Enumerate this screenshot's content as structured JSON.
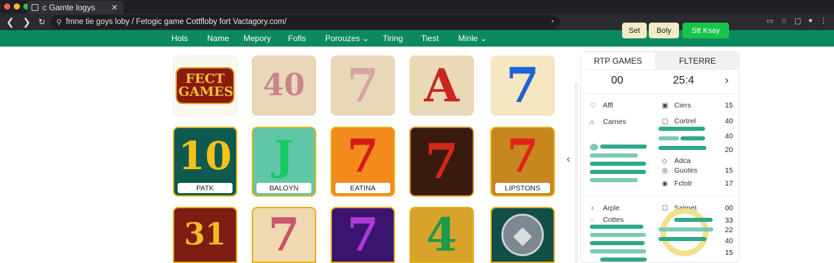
{
  "browser": {
    "tab_title": "c Gamte logys",
    "tab_close": "✕",
    "url": "fmne tie goys loby / Fetogic game Cottfloby fort Vactagory.com/",
    "back": "❮",
    "forward": "❯",
    "reload": "↻"
  },
  "nav": {
    "items": [
      "Hols",
      "Name",
      "Mepory",
      "Fofis",
      "Porouzes ⌄",
      "Tiring",
      "Tiest",
      "Minle ⌄"
    ]
  },
  "header_buttons": {
    "set": "Set",
    "body": "Boly",
    "cta": "Stt Ksay"
  },
  "tiles": [
    {
      "glyph": "FECT GAMES",
      "label": ""
    },
    {
      "glyph": "40",
      "label": ""
    },
    {
      "glyph": "7",
      "label": ""
    },
    {
      "glyph": "A",
      "label": ""
    },
    {
      "glyph": "7",
      "label": ""
    },
    {
      "glyph": "10",
      "label": "PATK"
    },
    {
      "glyph": "J",
      "label": "BALOYN"
    },
    {
      "glyph": "7",
      "label": "EATINA"
    },
    {
      "glyph": "7",
      "label": ""
    },
    {
      "glyph": "7",
      "label": "LIPSTONS"
    },
    {
      "glyph": "31",
      "label": ""
    },
    {
      "glyph": "7",
      "label": ""
    },
    {
      "glyph": "7",
      "label": ""
    },
    {
      "glyph": "4",
      "label": ""
    },
    {
      "glyph": "◆",
      "label": ""
    }
  ],
  "panel": {
    "tab_left": "RTP GAMES",
    "tab_right": "FLTERRE",
    "score_left": "00",
    "score_right": "25:4",
    "chevron": "›",
    "left_rows": [
      "Affl",
      "Carnes",
      "Arple",
      "Cottes"
    ],
    "right_rows": [
      "Ciers",
      "Cortrel",
      "Adca",
      "Guotes",
      "Fclotr",
      "Salmet"
    ],
    "numbers": [
      "15",
      "40",
      "40",
      "20",
      "15",
      "17",
      "00",
      "33",
      "22",
      "40",
      "15"
    ]
  },
  "colors": {
    "nav_green": "#0b8a5f",
    "cta_green": "#18c34b",
    "bar_teal": "#2fa88b"
  }
}
